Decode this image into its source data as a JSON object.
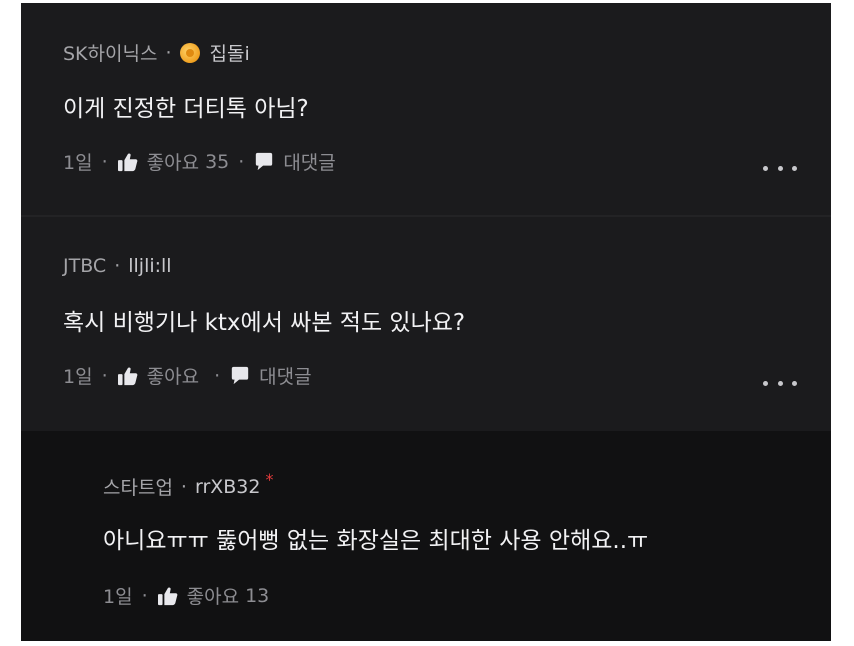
{
  "comments": [
    {
      "company": "SK하이닉스",
      "author": "집돌i",
      "text": "이게 진정한 더티톡 아님?",
      "time": "1일",
      "like_label": "좋아요",
      "like_count": "35",
      "reply_label": "대댓글"
    },
    {
      "company": "JTBC",
      "author": "lljli:ll",
      "text": "혹시 비행기나 ktx에서 싸본 적도 있나요?",
      "time": "1일",
      "like_label": "좋아요",
      "reply_label": "대댓글"
    }
  ],
  "reply": {
    "company": "스타트업",
    "author": "rrXB32",
    "author_mark": "*",
    "text": "아니요ㅠㅠ 뚫어뻥 없는 화장실은 최대한 사용 안해요..ㅠ",
    "time": "1일",
    "like_label": "좋아요",
    "like_count": "13"
  },
  "separator": "·",
  "icons": {
    "badge": "gold-medal-icon",
    "like": "thumbs-up-icon",
    "reply": "speech-bubble-icon",
    "more": "more-dots-icon"
  },
  "colors": {
    "background": "#1b1b1d",
    "reply_background": "#111112",
    "text": "#f2f2f4",
    "meta": "#a4a4a8",
    "author_mark": "#e23b3b"
  }
}
